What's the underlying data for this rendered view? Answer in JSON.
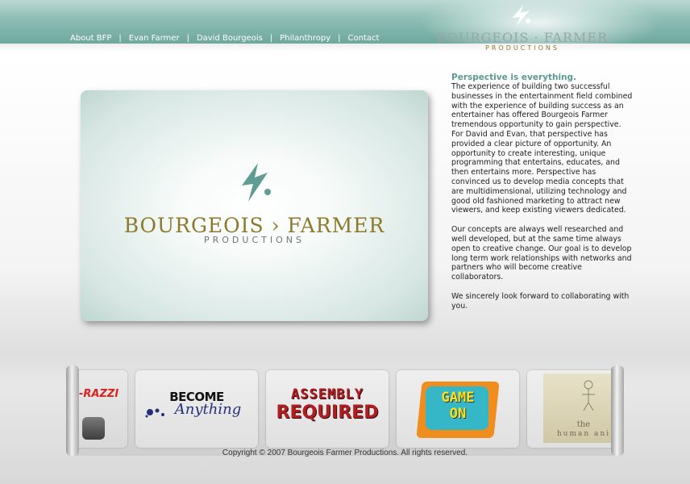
{
  "nav": {
    "items": [
      {
        "label": "About BFP"
      },
      {
        "label": "Evan Farmer"
      },
      {
        "label": "David Bourgeois"
      },
      {
        "label": "Philanthropy"
      },
      {
        "label": "Contact"
      }
    ],
    "separator": "|"
  },
  "logo": {
    "name": "BOURGEOIS · FARMER",
    "sub": "PRODUCTIONS"
  },
  "hero": {
    "name": "BOURGEOIS › FARMER",
    "sub": "PRODUCTIONS"
  },
  "content": {
    "heading": "Perspective is everything.",
    "paragraphs": [
      "The experience of building two successful businesses in the entertainment field combined with the experience of building success as an entertainer has offered Bourgeois Farmer tremendous opportunity to gain perspective. For David and Evan, that perspective has provided a clear picture of opportunity. An opportunity to create interesting, unique programming that entertains, educates, and then entertains more. Perspective has convinced us to develop media concepts that are multidimensional, utilizing technology and good old fashioned marketing to attract new viewers, and keep existing viewers dedicated.",
      "Our concepts are always well researched and well developed, but at the same time always open to creative change. Our goal is to develop long term work relationships with networks and partners who will become creative collaborators.",
      "We sincerely look forward to collaborating with you."
    ]
  },
  "carousel": {
    "thumbs": [
      {
        "label": "-RAZZI"
      },
      {
        "label_top": "BECOME",
        "label_bottom": "Anything"
      },
      {
        "label_top": "ASSEMBLY",
        "label_bottom": "REQUIRED"
      },
      {
        "label_top": "GAME",
        "label_bottom": "ON"
      },
      {
        "label_top": "the",
        "label_bottom": "human ani"
      }
    ]
  },
  "footer": {
    "copyright": "Copyright © 2007 Bourgeois Farmer Productions. All rights reserved."
  },
  "colors": {
    "header_teal": "#7fb3aa",
    "accent_teal": "#5a9a92",
    "gold": "#8c7a2a"
  }
}
